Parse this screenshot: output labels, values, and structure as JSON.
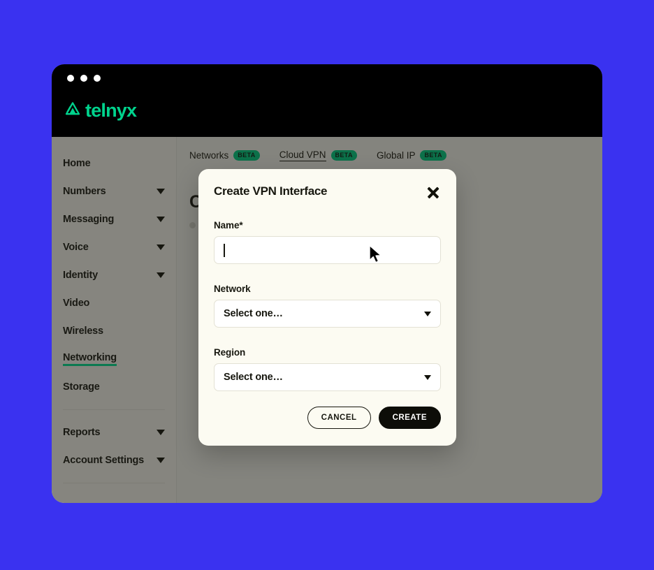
{
  "brand": {
    "name": "telnyx",
    "logo_icon": "telnyx-triangle-logo",
    "color": "#00d38d"
  },
  "window": {
    "traffic_lights": [
      "close",
      "minimize",
      "maximize"
    ]
  },
  "sidebar": {
    "items": [
      {
        "label": "Home",
        "expandable": false,
        "active": false
      },
      {
        "label": "Numbers",
        "expandable": true,
        "active": false
      },
      {
        "label": "Messaging",
        "expandable": true,
        "active": false
      },
      {
        "label": "Voice",
        "expandable": true,
        "active": false
      },
      {
        "label": "Identity",
        "expandable": true,
        "active": false
      },
      {
        "label": "Video",
        "expandable": false,
        "active": false
      },
      {
        "label": "Wireless",
        "expandable": false,
        "active": false
      },
      {
        "label": "Networking",
        "expandable": false,
        "active": true
      },
      {
        "label": "Storage",
        "expandable": false,
        "active": false
      }
    ],
    "footer_items": [
      {
        "label": "Reports",
        "expandable": true,
        "active": false
      },
      {
        "label": "Account Settings",
        "expandable": true,
        "active": false
      }
    ],
    "active_accent": "#00b877"
  },
  "content": {
    "tabs": [
      {
        "label": "Networks",
        "badge": "BETA",
        "active": false
      },
      {
        "label": "Cloud VPN",
        "badge": "BETA",
        "active": true
      },
      {
        "label": "Global IP",
        "badge": "BETA",
        "active": false
      }
    ],
    "badge_color": "#00a86b",
    "heading": "Cloud VPN",
    "subtext": ""
  },
  "modal": {
    "title": "Create VPN Interface",
    "close_icon": "close-x-icon",
    "fields": {
      "name": {
        "label": "Name",
        "required_marker": "*",
        "value": "",
        "placeholder": "",
        "focused": true
      },
      "network": {
        "label": "Network",
        "value": "Select one…",
        "caret_icon": "chevron-down-icon"
      },
      "region": {
        "label": "Region",
        "value": "Select one…",
        "caret_icon": "chevron-down-icon"
      }
    },
    "buttons": {
      "cancel": "CANCEL",
      "create": "CREATE"
    }
  },
  "cursor": {
    "icon": "mouse-arrow-cursor"
  }
}
